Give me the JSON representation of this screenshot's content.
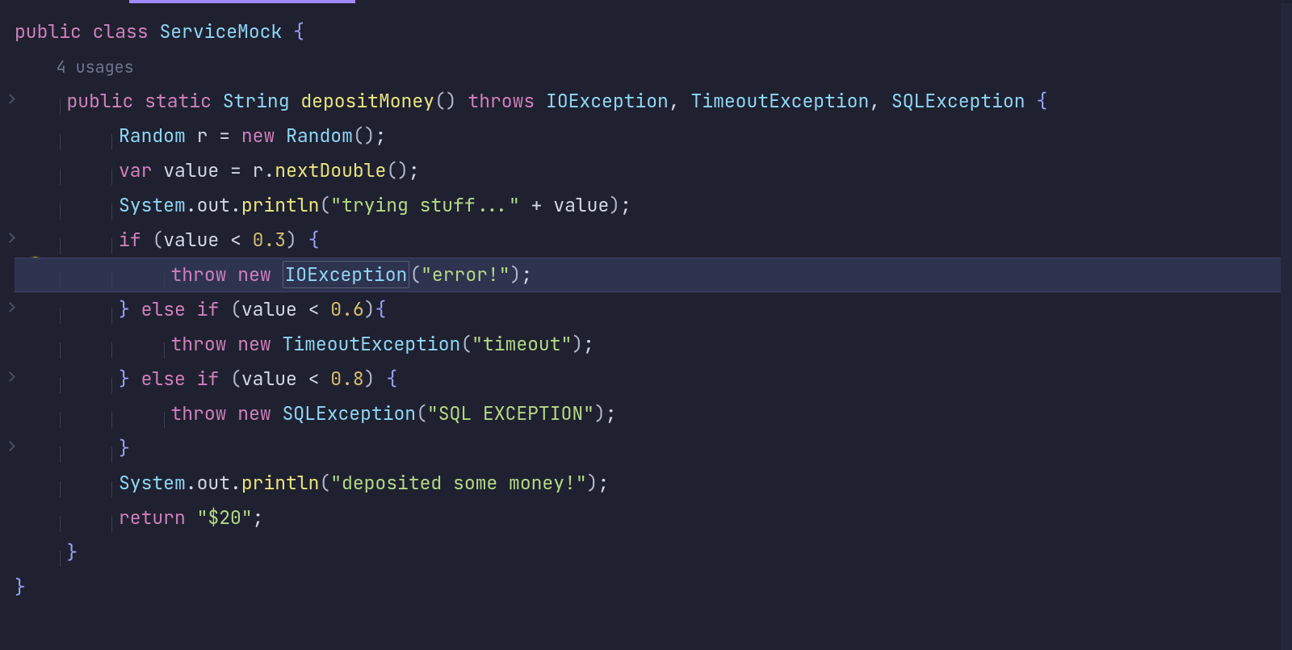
{
  "hints": {
    "usages": "4 usages"
  },
  "tokens": {
    "kw_public": "public",
    "kw_class": "class",
    "kw_static": "static",
    "kw_throws": "throws",
    "kw_new": "new",
    "kw_var": "var",
    "kw_if": "if",
    "kw_else": "else",
    "kw_throw": "throw",
    "kw_return": "return",
    "type_String": "String",
    "type_Random": "Random",
    "type_IOException": "IOException",
    "type_TimeoutException": "TimeoutException",
    "type_SQLException": "SQLException",
    "type_System": "System",
    "class_name": "ServiceMock",
    "method_name": "depositMoney",
    "id_r": "r",
    "id_value": "value",
    "id_out": "out",
    "id_println": "println",
    "id_nextDouble": "nextDouble",
    "num_03": "0.3",
    "num_06": "0.6",
    "num_08": "0.8",
    "str_trying": "\"trying stuff...\"",
    "str_error": "\"error!\"",
    "str_timeout": "\"timeout\"",
    "str_sqlex": "\"SQL EXCEPTION\"",
    "str_deposited": "\"deposited some money!\"",
    "str_twenty": "\"$20\"",
    "lparen": "(",
    "rparen": ")",
    "lbrace": "{",
    "rbrace": "}",
    "comma": ",",
    "semi": ";",
    "eq": "=",
    "lt": "<",
    "plus": "+",
    "dot": "."
  }
}
